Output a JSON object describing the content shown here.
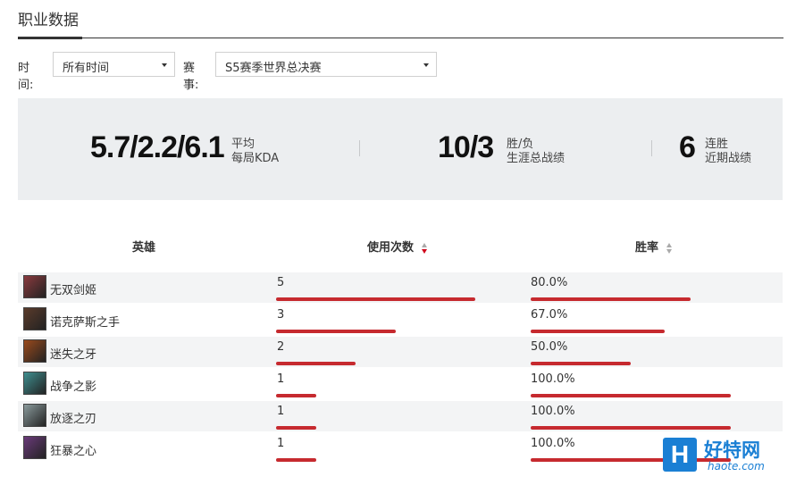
{
  "header": {
    "title": "职业数据"
  },
  "filters": {
    "time_label": "时间:",
    "time_value": "所有时间",
    "event_label": "赛事:",
    "event_value": "S5赛季世界总决赛"
  },
  "stats": {
    "kda": {
      "value": "5.7/2.2/6.1",
      "label1": "平均",
      "label2": "每局KDA"
    },
    "record": {
      "value": "10/3",
      "label1": "胜/负",
      "label2": "生涯总战绩"
    },
    "streak": {
      "value": "6",
      "label1": "连胜",
      "label2": "近期战绩"
    }
  },
  "table": {
    "headers": {
      "hero": "英雄",
      "uses": "使用次数",
      "winrate": "胜率"
    },
    "rows": [
      {
        "hero": "无双剑姬",
        "uses": "5",
        "uses_value": 5,
        "winrate": "80.0%",
        "winrate_value": 80.0,
        "avatar_color": "#8a3a3e"
      },
      {
        "hero": "诺克萨斯之手",
        "uses": "3",
        "uses_value": 3,
        "winrate": "67.0%",
        "winrate_value": 67.0,
        "avatar_color": "#5a3b2b"
      },
      {
        "hero": "迷失之牙",
        "uses": "2",
        "uses_value": 2,
        "winrate": "50.0%",
        "winrate_value": 50.0,
        "avatar_color": "#9a4a1c"
      },
      {
        "hero": "战争之影",
        "uses": "1",
        "uses_value": 1,
        "winrate": "100.0%",
        "winrate_value": 100.0,
        "avatar_color": "#3f8f90"
      },
      {
        "hero": "放逐之刃",
        "uses": "1",
        "uses_value": 1,
        "winrate": "100.0%",
        "winrate_value": 100.0,
        "avatar_color": "#8a9a9c"
      },
      {
        "hero": "狂暴之心",
        "uses": "1",
        "uses_value": 1,
        "winrate": "100.0%",
        "winrate_value": 100.0,
        "avatar_color": "#6a3a7a"
      }
    ]
  },
  "colors": {
    "accent": "#c62a2f",
    "stats_bg": "#eceef0",
    "watermark": "#1a7fd4"
  },
  "watermark": {
    "logo": "H",
    "cn": "好特网",
    "en": "haote.com"
  }
}
